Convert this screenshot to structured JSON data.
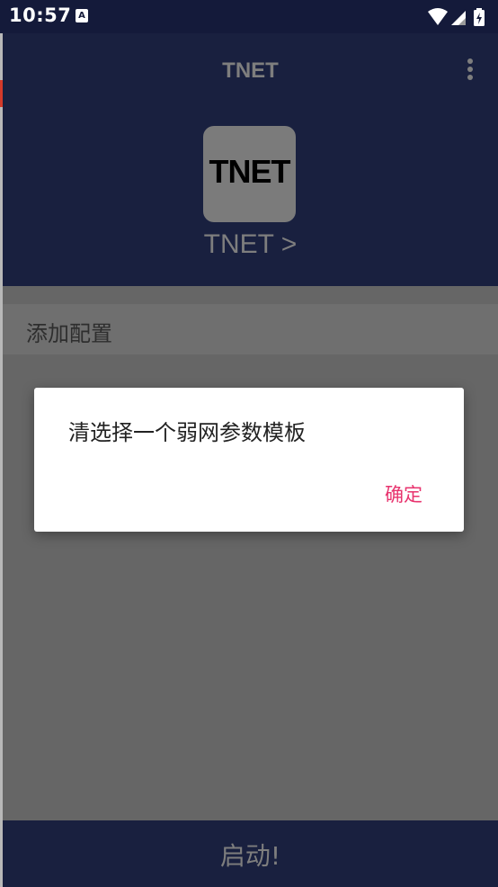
{
  "status_bar": {
    "time": "10:57",
    "notification_icon": "app-notification-icon",
    "icons": [
      "wifi-icon",
      "signal-icon",
      "battery-charging-icon"
    ]
  },
  "app_bar": {
    "title": "TNET",
    "logo_text": "TNET",
    "profile_link": "TNET >",
    "overflow_icon": "more-vert-icon"
  },
  "list": {
    "add_config_label": "添加配置"
  },
  "bottom_bar": {
    "start_label": "启动!"
  },
  "dialog": {
    "message": "清选择一个弱网参数模板",
    "ok_label": "确定"
  },
  "colors": {
    "primary_dark": "#19203f",
    "scrim_gray": "#666666",
    "accent": "#e8336e"
  }
}
